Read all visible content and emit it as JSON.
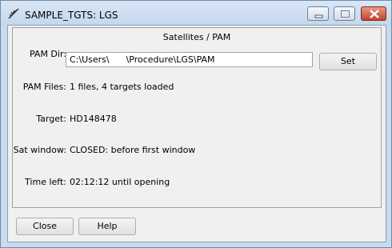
{
  "window": {
    "title": "SAMPLE_TGTS: LGS"
  },
  "panel": {
    "title": "Satellites / PAM"
  },
  "fields": {
    "pam_dir_label": "PAM Dir:",
    "pam_dir_value": "C:\\Users\\      \\Procedure\\LGS\\PAM",
    "pam_files_label": "PAM Files:",
    "pam_files_value": "1 files, 4 targets loaded",
    "target_label": "Target:",
    "target_value": "HD148478",
    "sat_window_label": "Sat window:",
    "sat_window_value": "CLOSED: before first window",
    "time_left_label": "Time left:",
    "time_left_value": "02:12:12 until opening"
  },
  "buttons": {
    "set": "Set",
    "close": "Close",
    "help": "Help"
  },
  "icons": {
    "app": "feather-app-icon",
    "minimize": "minimize-icon",
    "maximize": "maximize-icon",
    "close": "close-icon"
  }
}
